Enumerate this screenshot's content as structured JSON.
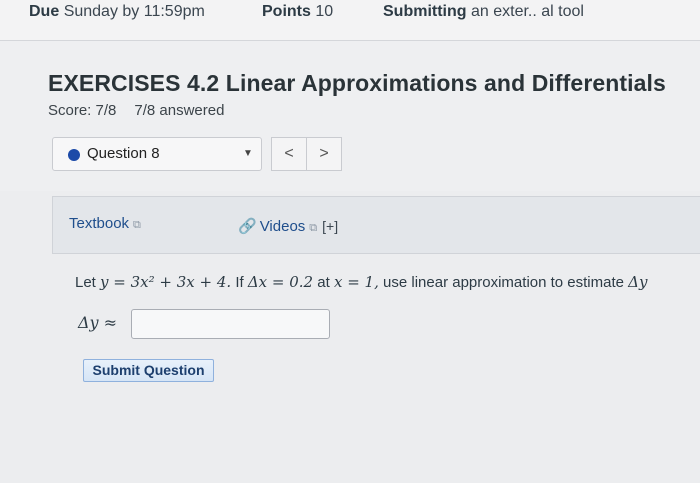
{
  "header": {
    "due_label": "Due",
    "due_value": "Sunday by 11:59pm",
    "points_label": "Points",
    "points_value": "10",
    "submitting_label": "Submitting",
    "submitting_value": "an exter.. al tool"
  },
  "assignment": {
    "title": "EXERCISES 4.2 Linear Approximations and Differentials",
    "score": "Score: 7/8",
    "answered": "7/8 answered"
  },
  "question_nav": {
    "selected": "Question 8",
    "caret": "▼",
    "prev": "<",
    "next": ">"
  },
  "help": {
    "textbook": "Textbook",
    "videos": "Videos",
    "expand": "[+]",
    "external_icon": "⧉",
    "clip_icon": "🔗"
  },
  "question": {
    "prefix": "Let",
    "expr1": "y = 3x² + 3x + 4.",
    "mid": "If",
    "expr2": "Δx = 0.2",
    "at": "at",
    "expr3": "x = 1,",
    "tail": "use linear approximation to estimate",
    "expr4": "Δy"
  },
  "answer": {
    "label": "Δy ≈",
    "value": "",
    "placeholder": ""
  },
  "submit_label": "Submit Question",
  "colors": {
    "accent_link": "#1f4e8c",
    "dot": "#1c4aa8",
    "submit_bg": "#d6e5f6"
  }
}
